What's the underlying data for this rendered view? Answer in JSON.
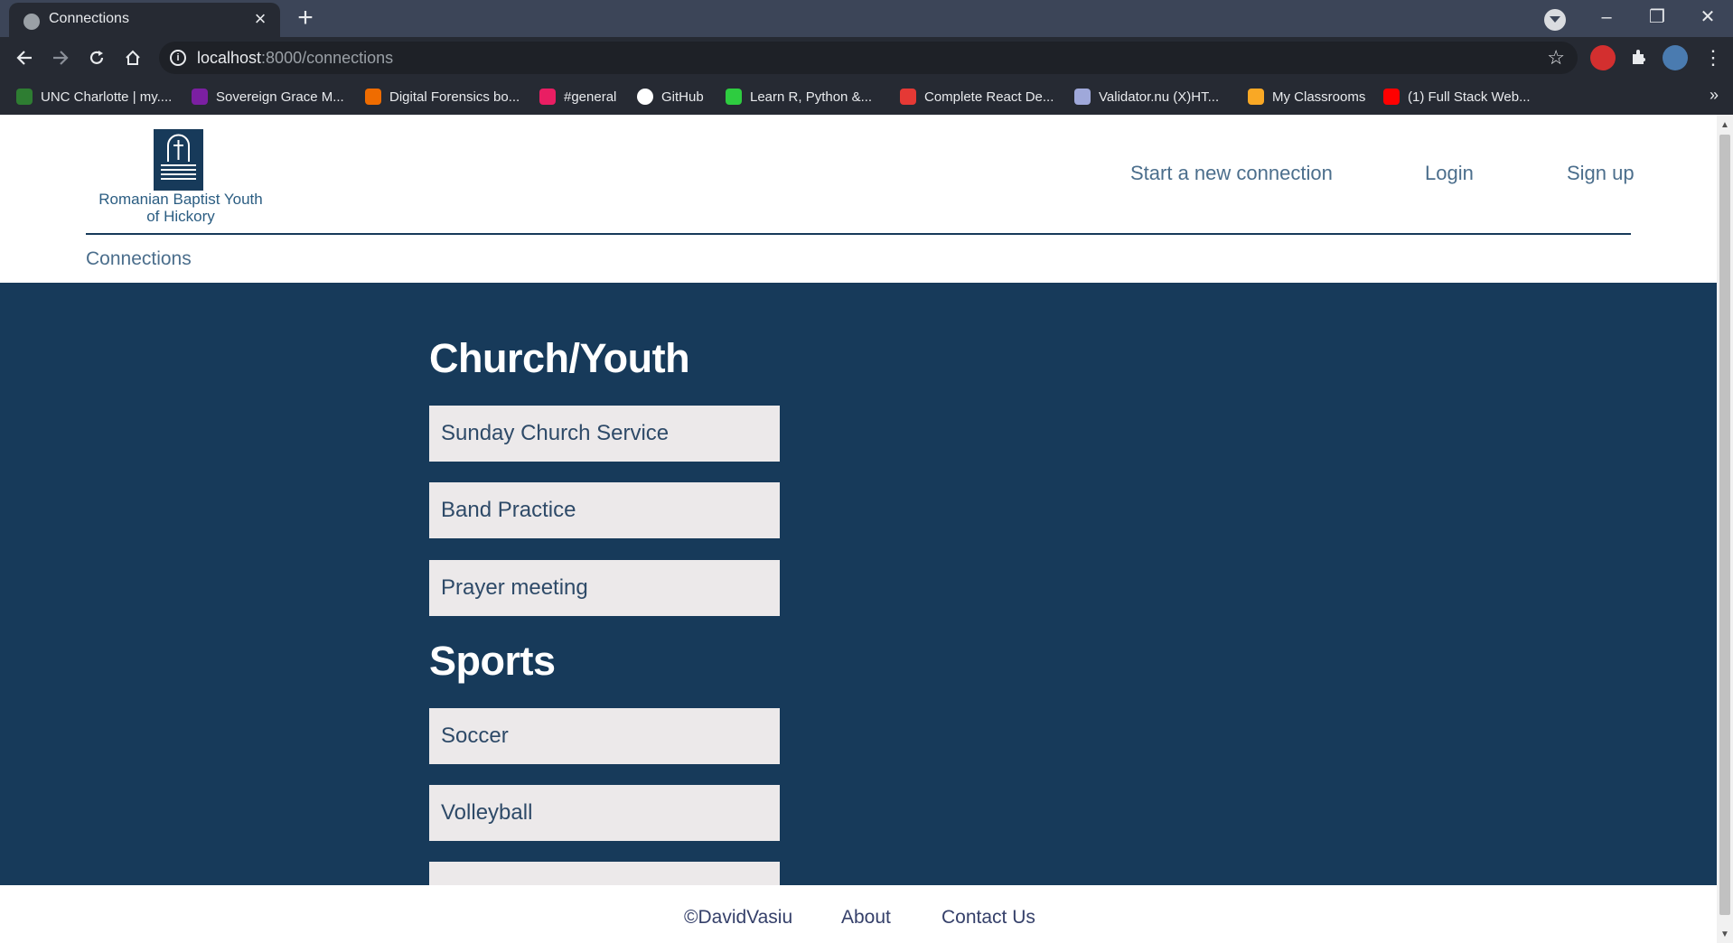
{
  "browser": {
    "tab_title": "Connections",
    "new_tab": "+",
    "url_host": "localhost",
    "url_path": ":8000/connections",
    "bookmarks": [
      {
        "label": "UNC Charlotte | my....",
        "color": "#2e7d32"
      },
      {
        "label": "Sovereign Grace M...",
        "color": "#7b1fa2"
      },
      {
        "label": "Digital Forensics bo...",
        "color": "#ef6c00"
      },
      {
        "label": "#general",
        "color": "#e91e63"
      },
      {
        "label": "GitHub",
        "color": "#ffffff"
      },
      {
        "label": "Learn R, Python &...",
        "color": "#2ecc40"
      },
      {
        "label": "Complete React De...",
        "color": "#e53935"
      },
      {
        "label": "Validator.nu (X)HT...",
        "color": "#9fa8da"
      },
      {
        "label": "My Classrooms",
        "color": "#f9a825"
      },
      {
        "label": "(1) Full Stack Web...",
        "color": "#ff0000"
      }
    ],
    "bookmarks_more": "»"
  },
  "header": {
    "logo_line1": "Romanian Baptist Youth",
    "logo_line2": "of Hickory",
    "nav": [
      "Start a new connection",
      "Login",
      "Sign up"
    ],
    "breadcrumb": "Connections"
  },
  "main": {
    "categories": [
      {
        "name": "Church/Youth",
        "items": [
          "Sunday Church Service",
          "Band Practice",
          "Prayer meeting"
        ]
      },
      {
        "name": "Sports",
        "items": [
          "Soccer",
          "Volleyball"
        ]
      }
    ]
  },
  "footer": {
    "copyright": "©DavidVasiu",
    "about": "About",
    "contact": "Contact Us"
  },
  "colors": {
    "brand_navy": "#173a5a",
    "item_bg": "#ece9ea",
    "link": "#4b6e8c"
  }
}
